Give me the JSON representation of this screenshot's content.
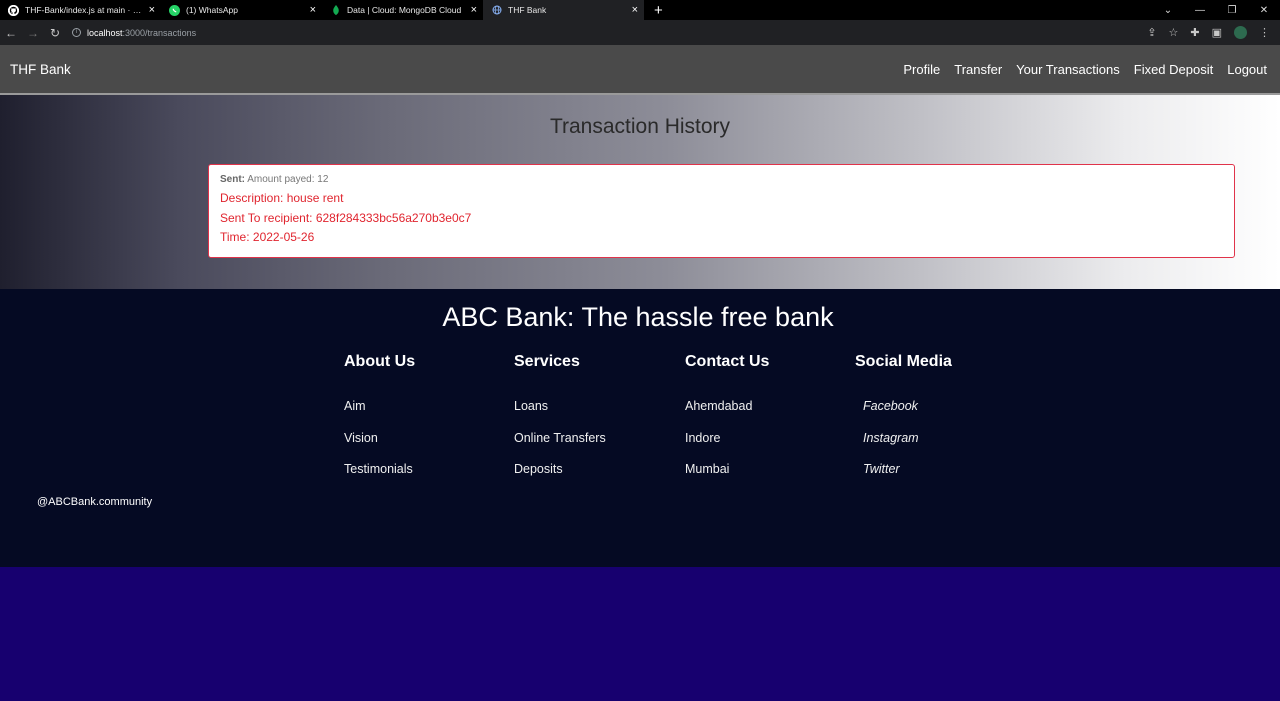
{
  "browser": {
    "tabs": [
      {
        "title": "THF-Bank/index.js at main · Parth",
        "icon": "github-icon"
      },
      {
        "title": "(1) WhatsApp",
        "icon": "whatsapp-icon"
      },
      {
        "title": "Data | Cloud: MongoDB Cloud",
        "icon": "mongodb-icon"
      },
      {
        "title": "THF Bank",
        "icon": "globe-icon"
      }
    ],
    "url_host": "localhost",
    "url_path": ":3000/transactions"
  },
  "navbar": {
    "brand": "THF Bank",
    "links": [
      "Profile",
      "Transfer",
      "Your Transactions",
      "Fixed Deposit",
      "Logout"
    ]
  },
  "main": {
    "title": "Transaction History",
    "transaction": {
      "sent_label": "Sent:",
      "amount_text": "Amount payed: 12",
      "description": "Description: house rent",
      "recipient": "Sent To recipient: 628f284333bc56a270b3e0c7",
      "time": "Time: 2022-05-26"
    }
  },
  "footer": {
    "title": "ABC Bank: The hassle free bank",
    "columns": [
      {
        "heading": "About Us",
        "items": [
          "Aim",
          "Vision",
          "Testimonials"
        ]
      },
      {
        "heading": "Services",
        "items": [
          "Loans",
          "Online Transfers",
          "Deposits"
        ]
      },
      {
        "heading": "Contact Us",
        "items": [
          "Ahemdabad",
          "Indore",
          "Mumbai"
        ]
      },
      {
        "heading": "Social Media",
        "items": [
          "Facebook",
          "Instagram",
          "Twitter"
        ]
      }
    ],
    "handle": "@ABCBank.community"
  },
  "colors": {
    "navbar": "#4a4a4a",
    "footer": "#050a23",
    "page_bottom": "#17006f",
    "transaction_text": "#e0252f"
  }
}
